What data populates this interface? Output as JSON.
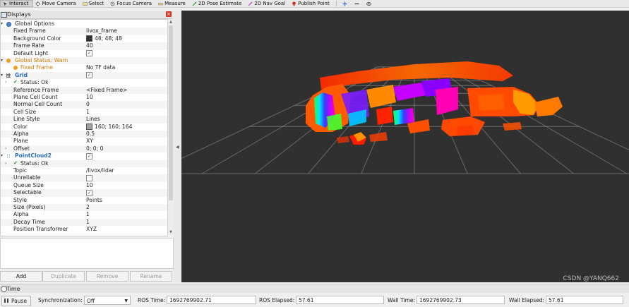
{
  "toolbar": {
    "tools": [
      {
        "label": "Interact",
        "icon": "interact-icon",
        "active": true
      },
      {
        "label": "Move Camera",
        "icon": "move-camera-icon"
      },
      {
        "label": "Select",
        "icon": "select-icon"
      },
      {
        "label": "Focus Camera",
        "icon": "focus-camera-icon"
      },
      {
        "label": "Measure",
        "icon": "measure-icon"
      },
      {
        "label": "2D Pose Estimate",
        "icon": "pose-estimate-icon"
      },
      {
        "label": "2D Nav Goal",
        "icon": "nav-goal-icon"
      },
      {
        "label": "Publish Point",
        "icon": "publish-point-icon"
      }
    ],
    "extra": [
      "plus-icon",
      "minus-icon",
      "eye-icon"
    ]
  },
  "displays": {
    "title": "Displays",
    "rows": [
      {
        "key": "Global Options",
        "indent": 1,
        "style": "plain",
        "icon": "gear-icon",
        "expander": "v"
      },
      {
        "key": "Fixed Frame",
        "indent": 2,
        "value": "livox_frame"
      },
      {
        "key": "Background Color",
        "indent": 2,
        "value": "48; 48; 48",
        "swatch": "#303030"
      },
      {
        "key": "Frame Rate",
        "indent": 2,
        "value": "40"
      },
      {
        "key": "Default Light",
        "indent": 2,
        "check": true
      },
      {
        "key": "Global Status: Warn",
        "indent": 1,
        "style": "orange",
        "icon": "warn-icon",
        "expander": "v"
      },
      {
        "key": "Fixed Frame",
        "indent": 2,
        "style": "orange",
        "icon": "warn-icon",
        "value": "No TF data"
      },
      {
        "key": "Grid",
        "indent": 1,
        "style": "blue",
        "icon": "grid-icon",
        "expander": "v",
        "check": true
      },
      {
        "key": "Status: Ok",
        "indent": 2,
        "icon": "ok-icon",
        "expander": ">"
      },
      {
        "key": "Reference Frame",
        "indent": 2,
        "value": "<Fixed Frame>"
      },
      {
        "key": "Plane Cell Count",
        "indent": 2,
        "value": "10"
      },
      {
        "key": "Normal Cell Count",
        "indent": 2,
        "value": "0"
      },
      {
        "key": "Cell Size",
        "indent": 2,
        "value": "1"
      },
      {
        "key": "Line Style",
        "indent": 2,
        "value": "Lines"
      },
      {
        "key": "Color",
        "indent": 2,
        "value": "160; 160; 164",
        "swatch": "#a0a0a4"
      },
      {
        "key": "Alpha",
        "indent": 2,
        "value": "0.5"
      },
      {
        "key": "Plane",
        "indent": 2,
        "value": "XY"
      },
      {
        "key": "Offset",
        "indent": 2,
        "value": "0; 0; 0",
        "expander": ">"
      },
      {
        "key": "PointCloud2",
        "indent": 1,
        "style": "blue",
        "icon": "pointcloud-icon",
        "expander": "v",
        "check": true
      },
      {
        "key": "Status: Ok",
        "indent": 2,
        "icon": "ok-icon",
        "expander": ">"
      },
      {
        "key": "Topic",
        "indent": 2,
        "value": "/livox/lidar"
      },
      {
        "key": "Unreliable",
        "indent": 2,
        "check": false
      },
      {
        "key": "Queue Size",
        "indent": 2,
        "value": "10"
      },
      {
        "key": "Selectable",
        "indent": 2,
        "check": true
      },
      {
        "key": "Style",
        "indent": 2,
        "value": "Points"
      },
      {
        "key": "Size (Pixels)",
        "indent": 2,
        "value": "2"
      },
      {
        "key": "Alpha",
        "indent": 2,
        "value": "1"
      },
      {
        "key": "Decay Time",
        "indent": 2,
        "value": "1"
      },
      {
        "key": "Position Transformer",
        "indent": 2,
        "value": "XYZ"
      }
    ],
    "buttons": [
      {
        "label": "Add",
        "enabled": true
      },
      {
        "label": "Duplicate",
        "enabled": false
      },
      {
        "label": "Remove",
        "enabled": false
      },
      {
        "label": "Rename",
        "enabled": false
      }
    ]
  },
  "viewport": {
    "background": "#303030",
    "grid_color": "#a0a0a4",
    "watermark": "CSDN @YANQ662"
  },
  "time": {
    "title": "Time",
    "pause_label": "Pause",
    "sync_label": "Synchronization:",
    "sync_value": "Off",
    "ros_time_label": "ROS Time:",
    "ros_time": "1692769902.71",
    "ros_elapsed_label": "ROS Elapsed:",
    "ros_elapsed": "57.61",
    "wall_time_label": "Wall Time:",
    "wall_time": "1692769902.73",
    "wall_elapsed_label": "Wall Elapsed:",
    "wall_elapsed": "57.61"
  }
}
